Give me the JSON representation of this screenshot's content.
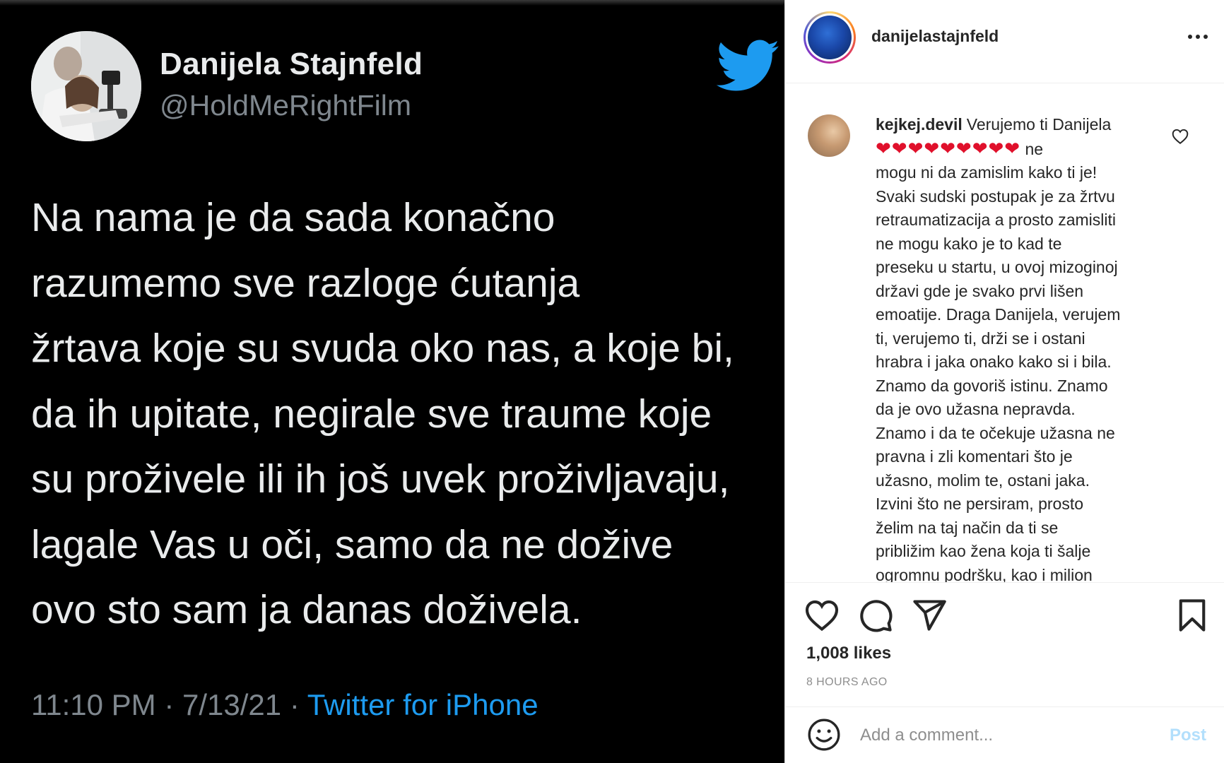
{
  "tweet": {
    "display_name": "Danijela Stajnfeld",
    "handle": "@HoldMeRightFilm",
    "text_lines": [
      "Na nama je da sada konačno",
      "razumemo sve razloge ćutanja",
      "žrtava koje su svuda oko nas, a koje bi,",
      "da ih upitate, negirale sve traume koje",
      "su proživele ili ih još uvek proživljavaju,",
      "lagale Vas u oči, samo da ne dožive",
      "ovo sto sam ja danas doživela."
    ],
    "time": "11:10 PM",
    "separator": "·",
    "date": "7/13/21",
    "source": "Twitter for iPhone",
    "icon": "twitter-bird-icon",
    "brand_color": "#1d9bf0"
  },
  "post": {
    "username": "danijelastajnfeld",
    "more_icon": "more-options-icon",
    "comment": {
      "author": "kejkej.devil",
      "first_words": "Verujemo ti Danijela",
      "hearts": "❤❤❤❤❤❤❤❤❤",
      "lines": [
        "ne",
        "mogu ni da zamislim kako ti je!",
        "Svaki sudski postupak je za žrtvu",
        "retraumatizacija a prosto zamisliti",
        "ne mogu kako je to kad te",
        "preseku u startu, u ovoj mizoginoj",
        "državi gde je svako prvi lišen",
        "emoatije. Draga Danijela, verujem",
        "ti, verujemo ti, drži se i ostani",
        "hrabra i jaka onako kako si i bila.",
        "Znamo da govoriš istinu. Znamo",
        "da je ovo užasna nepravda.",
        "Znamo i da te očekuje užasna ne",
        "pravna i zli komentari što je",
        "užasno, molim te, ostani jaka.",
        "Izvini što ne persiram, prosto",
        "želim na taj način da ti se",
        "približim kao žena koja ti šalje",
        "ogromnu podršku, kao i milion"
      ],
      "like_icon": "heart-outline-icon",
      "heart_color": "#e0102b"
    },
    "actions": {
      "like_icon": "heart-icon",
      "comment_icon": "comment-bubble-icon",
      "share_icon": "paper-plane-icon",
      "save_icon": "bookmark-icon"
    },
    "likes": "1,008 likes",
    "time_ago": "8 HOURS AGO",
    "add_comment": {
      "emoji_icon": "emoji-icon",
      "placeholder": "Add a comment...",
      "post_label": "Post",
      "post_color": "#b2dffc"
    }
  }
}
